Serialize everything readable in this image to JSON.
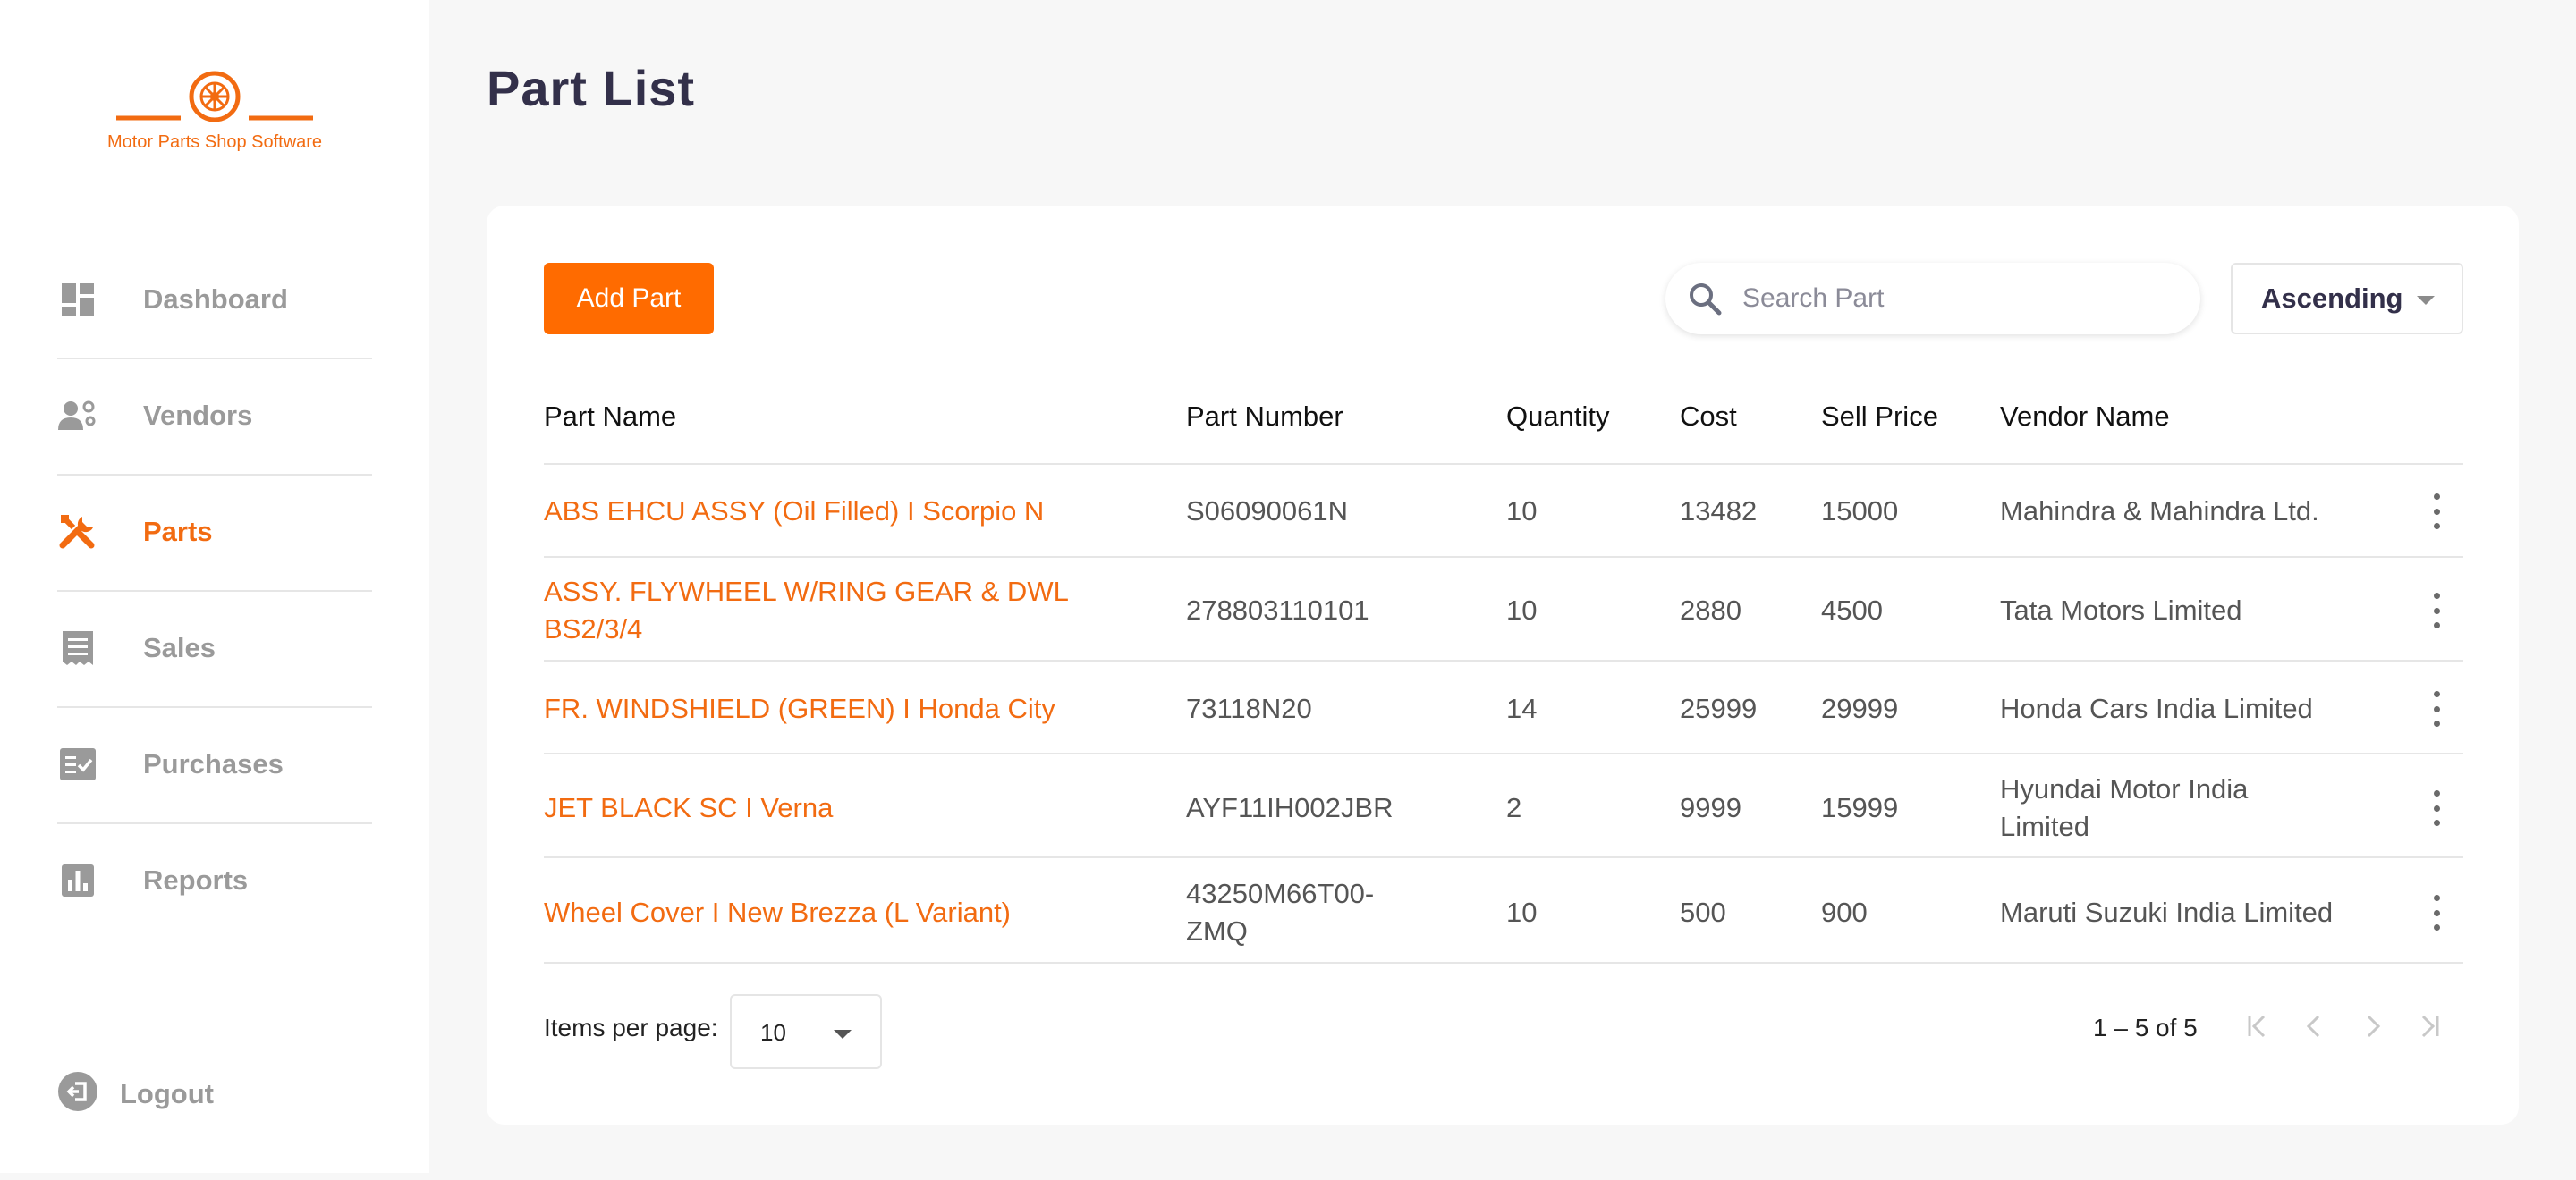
{
  "brand": {
    "name": "Motor Parts Shop Software",
    "color": "#f26b11"
  },
  "sidebar": {
    "items": [
      {
        "label": "Dashboard",
        "icon": "dashboard-icon",
        "active": false
      },
      {
        "label": "Vendors",
        "icon": "vendors-icon",
        "active": false
      },
      {
        "label": "Parts",
        "icon": "tools-icon",
        "active": true
      },
      {
        "label": "Sales",
        "icon": "receipt-icon",
        "active": false
      },
      {
        "label": "Purchases",
        "icon": "checklist-icon",
        "active": false
      },
      {
        "label": "Reports",
        "icon": "bar-chart-icon",
        "active": false
      }
    ],
    "logout": {
      "label": "Logout",
      "icon": "logout-icon"
    }
  },
  "page": {
    "title": "Part List"
  },
  "toolbar": {
    "add_label": "Add Part",
    "search_placeholder": "Search Part",
    "sort_label": "Ascending"
  },
  "table": {
    "headers": [
      "Part Name",
      "Part Number",
      "Quantity",
      "Cost",
      "Sell Price",
      "Vendor Name"
    ],
    "rows": [
      {
        "name_lines": [
          "ABS EHCU ASSY (Oil Filled) I Scorpio N"
        ],
        "number_lines": [
          "S06090061N"
        ],
        "qty": "10",
        "cost": "13482",
        "sell": "15000",
        "vendor_lines": [
          "Mahindra & Mahindra Ltd."
        ]
      },
      {
        "name_lines": [
          "ASSY. FLYWHEEL W/RING GEAR & DWL",
          "BS2/3/4"
        ],
        "number_lines": [
          "278803110101"
        ],
        "qty": "10",
        "cost": "2880",
        "sell": "4500",
        "vendor_lines": [
          "Tata Motors Limited"
        ]
      },
      {
        "name_lines": [
          "FR. WINDSHIELD (GREEN) I Honda City"
        ],
        "number_lines": [
          "73118N20"
        ],
        "qty": "14",
        "cost": "25999",
        "sell": "29999",
        "vendor_lines": [
          "Honda Cars India Limited"
        ]
      },
      {
        "name_lines": [
          "JET BLACK SC I Verna"
        ],
        "number_lines": [
          "AYF11IH002JBR"
        ],
        "qty": "2",
        "cost": "9999",
        "sell": "15999",
        "vendor_lines": [
          "Hyundai Motor India",
          "Limited"
        ]
      },
      {
        "name_lines": [
          "Wheel Cover I New Brezza (L Variant)"
        ],
        "number_lines": [
          "43250M66T00-",
          "ZMQ"
        ],
        "qty": "10",
        "cost": "500",
        "sell": "900",
        "vendor_lines": [
          "Maruti Suzuki India Limited"
        ]
      }
    ]
  },
  "pagination": {
    "items_per_page_label": "Items per page:",
    "items_per_page_value": "10",
    "range_label": "1 – 5 of 5"
  }
}
